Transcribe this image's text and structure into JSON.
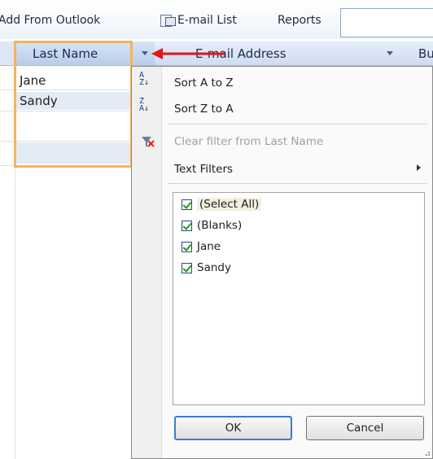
{
  "toolbar": {
    "add_from_outlook": "Add From Outlook",
    "email_list": "E-mail List",
    "reports": "Reports"
  },
  "table": {
    "columns": [
      "Last Name",
      "E-mail Address",
      "Bu"
    ],
    "rows": [
      "Jane",
      "Sandy"
    ]
  },
  "filter_menu": {
    "sort_az": "Sort A to Z",
    "sort_za": "Sort Z to A",
    "clear_filter": "Clear filter from Last Name",
    "text_filters": "Text Filters",
    "values": [
      "(Select All)",
      "(Blanks)",
      "Jane",
      "Sandy"
    ],
    "ok": "OK",
    "cancel": "Cancel"
  },
  "colors": {
    "selection_frame": "#f6b35e",
    "annotation_arrow": "#e0161b",
    "header": "#cfdcf1"
  }
}
